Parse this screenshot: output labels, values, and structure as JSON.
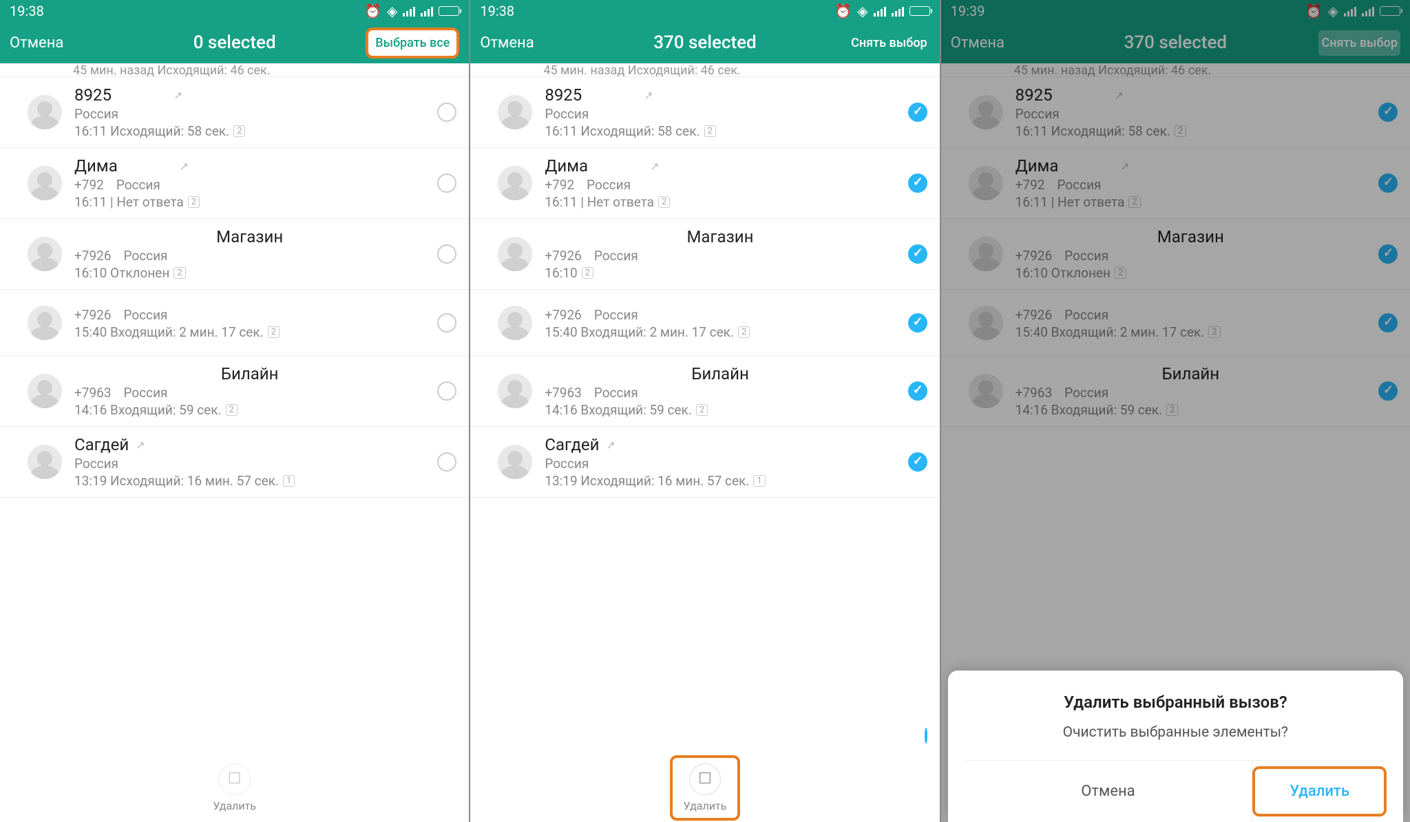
{
  "phone1": {
    "time": "19:38",
    "cancel": "Отмена",
    "title": "0 selected",
    "action": "Выбрать все",
    "clipped": "45 мин. назад Исходящий: 46 сек.",
    "delete_label": "Удалить"
  },
  "phone2": {
    "time": "19:38",
    "cancel": "Отмена",
    "title": "370 selected",
    "action": "Снять выбор",
    "clipped": "45 мин. назад Исходящий: 46 сек.",
    "delete_label": "Удалить"
  },
  "phone3": {
    "time": "19:39",
    "cancel": "Отмена",
    "title": "370 selected",
    "action": "Снять выбор",
    "clipped": "45 мин. назад Исходящий: 46 сек.",
    "dialog_title": "Удалить выбранный вызов?",
    "dialog_msg": "Очистить выбранные элементы?",
    "dialog_cancel": "Отмена",
    "dialog_confirm": "Удалить"
  },
  "rows": [
    {
      "name": "8925",
      "sub1": "Россия",
      "sub2": "",
      "detail": "16:11 Исходящий: 58 сек.",
      "badge": "2",
      "arrow": true,
      "name_center": false
    },
    {
      "name": "Дима",
      "sub1": "+792",
      "sub2": "Россия",
      "detail": "16:11 | Нет ответа",
      "badge": "2",
      "arrow": true,
      "name_center": false
    },
    {
      "name": "Магазин",
      "sub1": "+7926",
      "sub2": "Россия",
      "detail": "16:10 Отклонен",
      "badge": "2",
      "arrow": false,
      "name_center": true
    },
    {
      "name": "",
      "sub1": "+7926",
      "sub2": "Россия",
      "detail": "15:40 Входящий: 2 мин. 17 сек.",
      "badge": "2",
      "arrow": false,
      "name_center": false
    },
    {
      "name": "Билайн",
      "sub1": "+7963",
      "sub2": "Россия",
      "detail": "14:16 Входящий: 59 сек.",
      "badge": "2",
      "arrow": false,
      "name_center": true
    },
    {
      "name": "Сагдей",
      "sub1": "",
      "sub2": "Россия",
      "detail": "13:19 Исходящий: 16 мин. 57 сек.",
      "badge": "1",
      "arrow": true,
      "name_center": false,
      "inline_arrow": true
    }
  ],
  "rows_p2_detail_override": {
    "2": "16:10"
  }
}
